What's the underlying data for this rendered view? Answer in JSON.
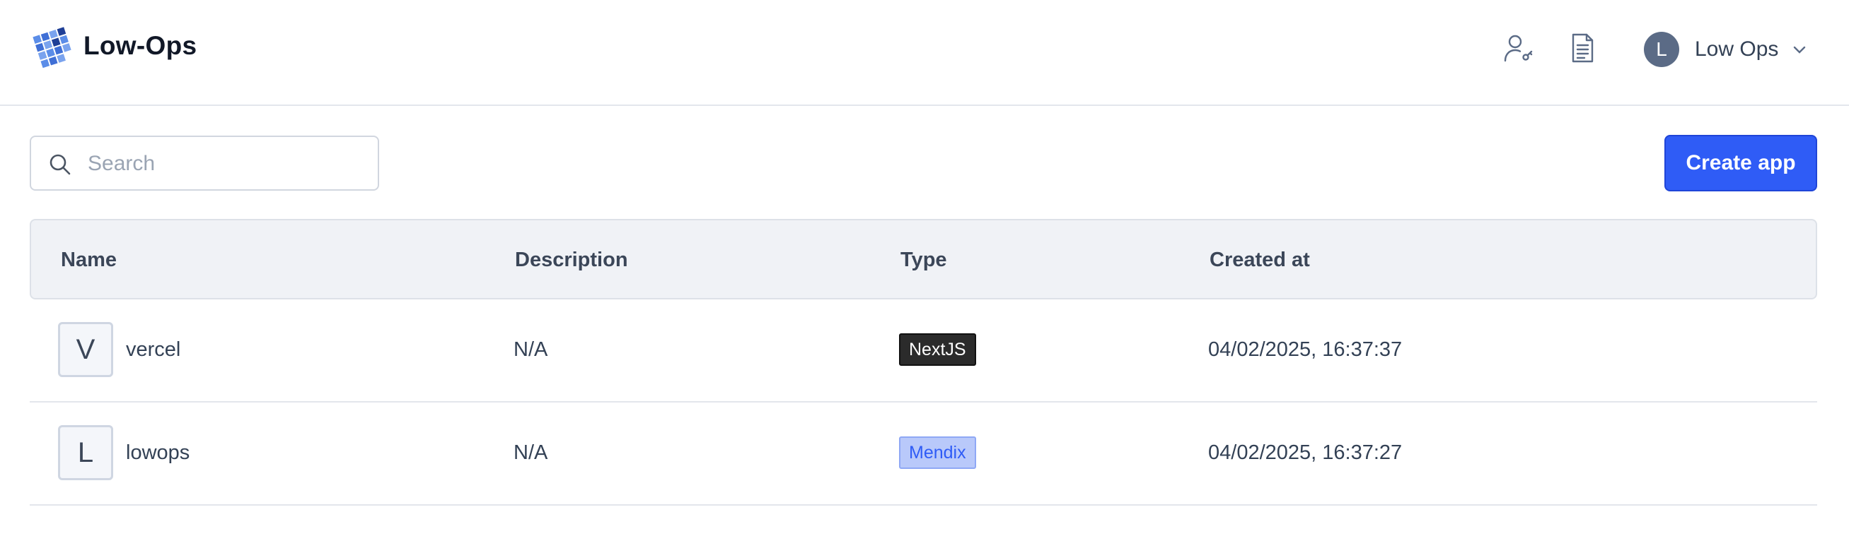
{
  "header": {
    "brand": "Low-Ops",
    "icons": [
      "user-key-icon",
      "document-icon"
    ],
    "user": {
      "initial": "L",
      "name": "Low Ops"
    }
  },
  "toolbar": {
    "search_placeholder": "Search",
    "search_value": "",
    "create_label": "Create app"
  },
  "table": {
    "columns": [
      "Name",
      "Description",
      "Type",
      "Created at"
    ],
    "rows": [
      {
        "initial": "V",
        "name": "vercel",
        "description": "N/A",
        "type": "NextJS",
        "type_style": "dark",
        "created_at": "04/02/2025, 16:37:37"
      },
      {
        "initial": "L",
        "name": "lowops",
        "description": "N/A",
        "type": "Mendix",
        "type_style": "blue",
        "created_at": "04/02/2025, 16:37:27"
      }
    ]
  },
  "colors": {
    "accent": "#2f5cf6",
    "avatar": "#5b6b86",
    "badge_dark": "#2b2b2b",
    "badge_blue": "#b9c9fa"
  }
}
